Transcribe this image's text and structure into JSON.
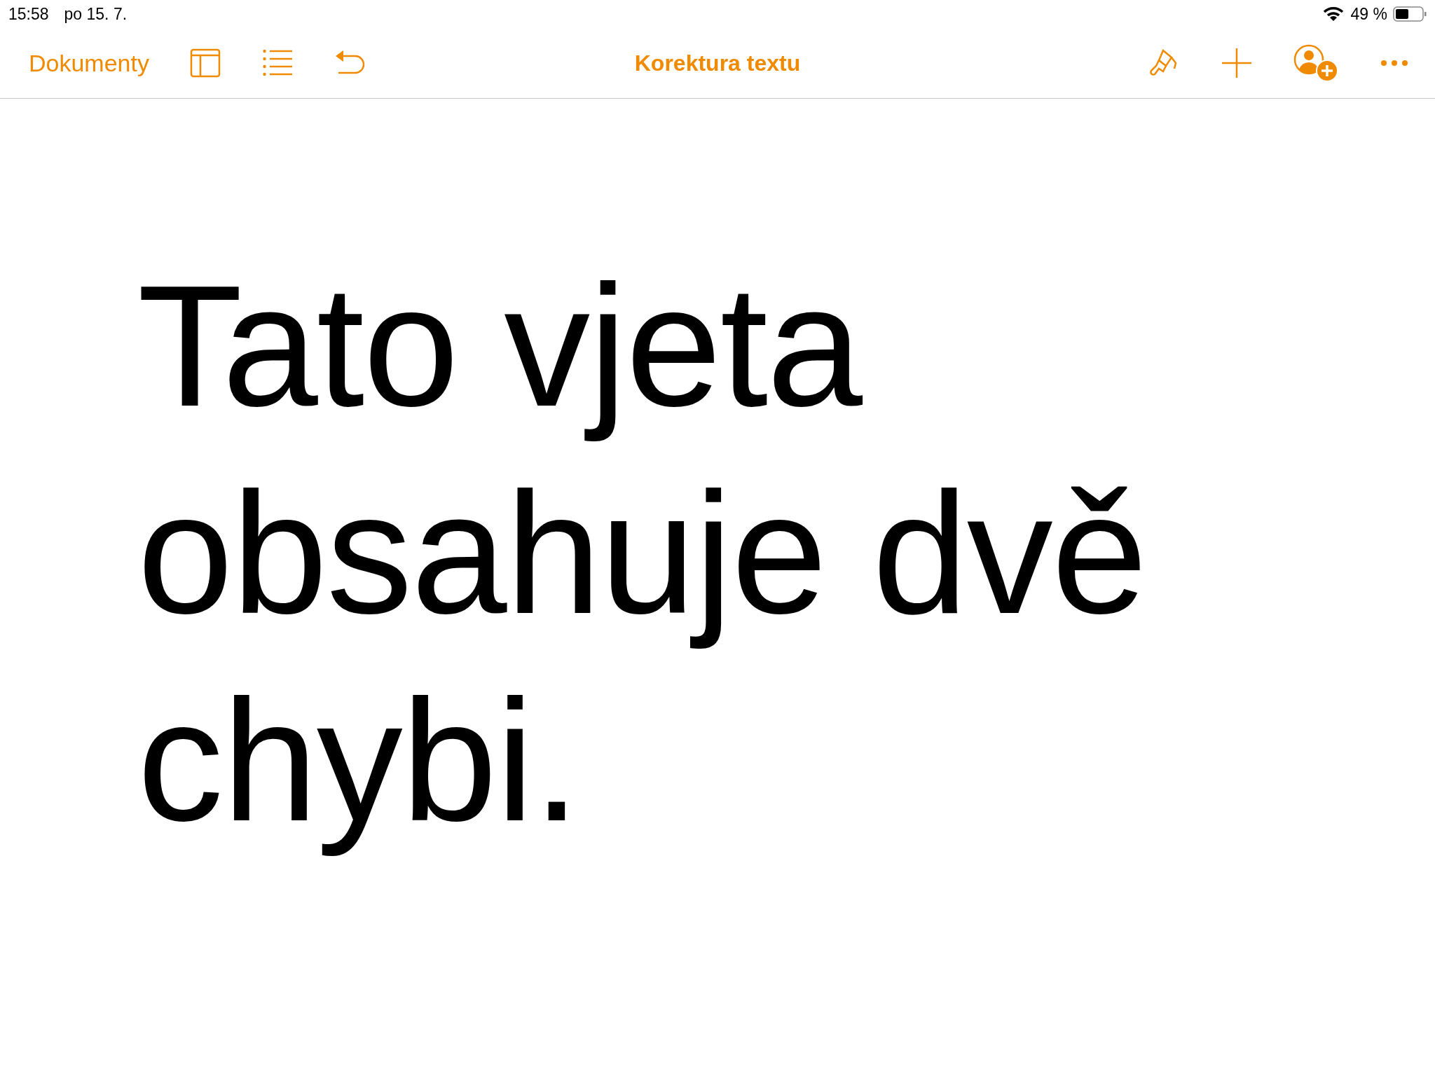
{
  "status_bar": {
    "time": "15:58",
    "date": "po 15. 7.",
    "battery": "49 %"
  },
  "toolbar": {
    "back": "Dokumenty",
    "title": "Korektura textu"
  },
  "document": {
    "text": "Tato vjeta obsahuje dvě chybi."
  }
}
